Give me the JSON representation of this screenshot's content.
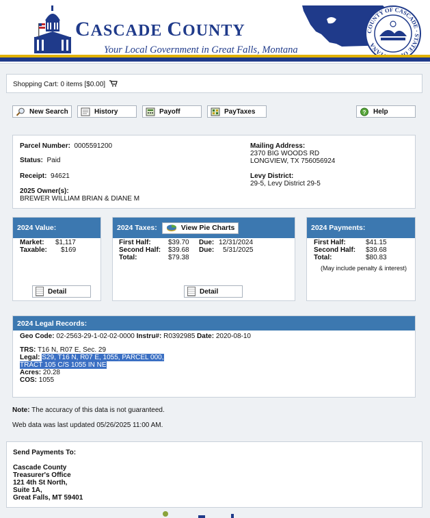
{
  "header": {
    "title_big_c": "C",
    "title_rest1": "ASCADE ",
    "title_big_c2": "C",
    "title_rest2": "OUNTY",
    "tagline": "Your Local Government in Great Falls, Montana",
    "seal_text": "COUNTY OF CASCADE · STATE OF MONTANA"
  },
  "cart": {
    "label": "Shopping Cart: 0 items [$0.00]"
  },
  "toolbar": {
    "new_search": "New Search",
    "history": "History",
    "payoff": "Payoff",
    "pay_taxes": "PayTaxes",
    "help": "Help"
  },
  "parcel": {
    "parcel_label": "Parcel Number:",
    "parcel_value": "0005591200",
    "status_label": "Status:",
    "status_value": "Paid",
    "receipt_label": "Receipt:",
    "receipt_value": "94621",
    "owners_label": "2025 Owner(s):",
    "owners_value": "BREWER WILLIAM BRIAN & DIANE M",
    "mailing_label": "Mailing Address:",
    "mailing_line1": "2370 BIG WOODS RD",
    "mailing_line2": "LONGVIEW, TX 756056924",
    "levy_label": "Levy District:",
    "levy_value": "29-5, Levy District 29-5"
  },
  "value_panel": {
    "title": "2024 Value:",
    "market_label": "Market:",
    "market_value": "$1,117",
    "taxable_label": "Taxable:",
    "taxable_value": "$169",
    "detail": "Detail"
  },
  "taxes_panel": {
    "title": "2024 Taxes:",
    "pie_button": "View Pie Charts",
    "first_half_label": "First Half:",
    "first_half_value": "$39.70",
    "first_due_label": "Due:",
    "first_due_value": "12/31/2024",
    "second_half_label": "Second Half:",
    "second_half_value": "$39.68",
    "second_due_label": "Due:",
    "second_due_value": "5/31/2025",
    "total_label": "Total:",
    "total_value": "$79.38",
    "detail": "Detail"
  },
  "payments_panel": {
    "title": "2024 Payments:",
    "first_half_label": "First Half:",
    "first_half_value": "$41.15",
    "second_half_label": "Second Half:",
    "second_half_value": "$39.68",
    "total_label": "Total:",
    "total_value": "$80.83",
    "note": "(May include penalty & interest)"
  },
  "legal": {
    "title": "2024 Legal Records:",
    "geo_label": "Geo Code:",
    "geo_value": "02-2563-29-1-02-02-0000",
    "instru_label": "Instru#:",
    "instru_value": "R0392985",
    "date_label": "Date:",
    "date_value": "2020-08-10",
    "trs_label": "TRS:",
    "trs_value": "T16 N, R07 E, Sec. 29",
    "legal_label": "Legal:",
    "legal_value1": "S29, T16 N, R07 E, 1055, PARCEL 000,",
    "legal_value2": "TRACT 105 C/S 1055 IN NE",
    "acres_label": "Acres:",
    "acres_value": "20.28",
    "cos_label": "COS:",
    "cos_value": "1055"
  },
  "notes": {
    "note_label": "Note:",
    "note_text": "The accuracy of this data is not guaranteed.",
    "updated": "Web data was last updated 05/26/2025 11:00 AM."
  },
  "send_payments": {
    "title": "Send Payments To:",
    "line1": "Cascade County",
    "line2": "Treasurer's Office",
    "line3": "121 4th St North,",
    "line4": "Suite 1A,",
    "line5": "Great Falls, MT 59401"
  },
  "colors": {
    "brand_blue": "#1f3a8a",
    "panel_header": "#3c78b0",
    "accent_yellow": "#e0b100",
    "highlight": "#3a6fc3"
  }
}
